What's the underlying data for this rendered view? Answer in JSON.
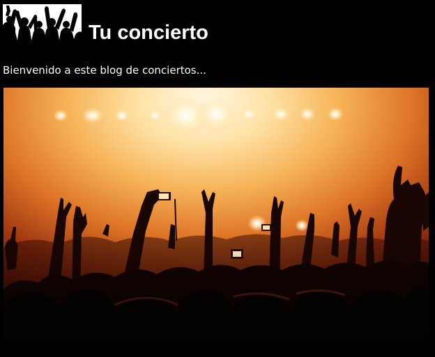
{
  "header": {
    "site_title": "Tu concierto",
    "logo_icon": "concert-crowd-logo-icon"
  },
  "main": {
    "welcome_text": "Bienvenido a este blog de conciertos...",
    "hero_image_icon": "concert-stage-photo"
  },
  "colors": {
    "background": "#000000",
    "text": "#ffffff",
    "stage_light": "#ffe9b8",
    "stage_glow": "#e07a22",
    "stage_dark": "#5a1206"
  }
}
